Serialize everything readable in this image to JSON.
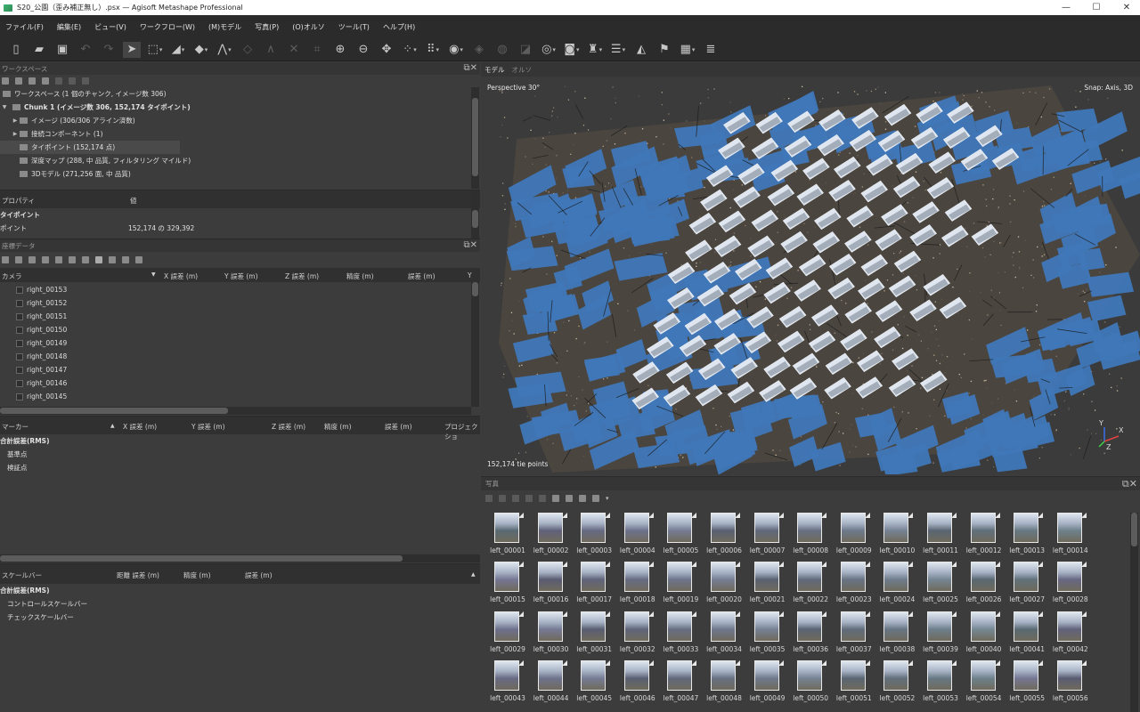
{
  "window": {
    "title": "S20_公園（歪み補正無し）.psx — Agisoft Metashape Professional",
    "controls": [
      "—",
      "☐",
      "✕"
    ]
  },
  "menu": [
    "ファイル(F)",
    "編集(E)",
    "ビュー(V)",
    "ワークフロー(W)",
    "(M)モデル",
    "写真(P)",
    "(O)オルソ",
    "ツール(T)",
    "ヘルプ(H)"
  ],
  "workspace": {
    "title": "ワークスペース",
    "root": "ワークスペース (1 個のチャンク, イメージ数 306)",
    "chunk": "Chunk 1 (イメージ数 306, 152,174 タイポイント)",
    "items": [
      "イメージ (306/306 アライン済数)",
      "接続コンポーネント (1)",
      "タイポイント (152,174 点)",
      "深度マップ (288, 中 品質, フィルタリング マイルド)",
      "3Dモデル (271,256 面, 中 品質)"
    ]
  },
  "properties": {
    "col_property": "プロパティ",
    "col_value": "値",
    "section": "タイポイント",
    "row_label": "ポイント",
    "row_value": "152,174 の 329,392"
  },
  "reference": {
    "title": "座標データ",
    "columns": [
      "カメラ",
      "X 誤差 (m)",
      "Y 誤差 (m)",
      "Z 誤差 (m)",
      "精度 (m)",
      "誤差 (m)",
      "Y"
    ],
    "cameras": [
      "right_00153",
      "right_00152",
      "right_00151",
      "right_00150",
      "right_00149",
      "right_00148",
      "right_00147",
      "right_00146",
      "right_00145"
    ]
  },
  "markers": {
    "columns": [
      "マーカー",
      "X 誤差 (m)",
      "Y 誤差 (m)",
      "Z 誤差 (m)",
      "精度 (m)",
      "誤差 (m)",
      "プロジェクショ"
    ],
    "total": "合計誤差(RMS)",
    "rows": [
      "基準点",
      "検証点"
    ]
  },
  "scalebars": {
    "columns": [
      "スケールバー",
      "距離 誤差 (m)",
      "精度 (m)",
      "誤差 (m)"
    ],
    "total": "合計誤差(RMS)",
    "rows": [
      "コントロールスケールバー",
      "チェックスケールバー"
    ]
  },
  "view_tabs": [
    "モデル",
    "オルソ"
  ],
  "viewport": {
    "projection": "Perspective 30°",
    "snap": "Snap: Axis, 3D",
    "points": "152,174 tie points",
    "axes": [
      "Y",
      "X",
      "Z"
    ]
  },
  "photos": {
    "title": "写真",
    "items": [
      "left_00001",
      "left_00002",
      "left_00003",
      "left_00004",
      "left_00005",
      "left_00006",
      "left_00007",
      "left_00008",
      "left_00009",
      "left_00010",
      "left_00011",
      "left_00012",
      "left_00013",
      "left_00014",
      "left_00015",
      "left_00016",
      "left_00017",
      "left_00018",
      "left_00019",
      "left_00020",
      "left_00021",
      "left_00022",
      "left_00023",
      "left_00024",
      "left_00025",
      "left_00026",
      "left_00027",
      "left_00028",
      "left_00029",
      "left_00030",
      "left_00031",
      "left_00032",
      "left_00033",
      "left_00034",
      "left_00035",
      "left_00036",
      "left_00037",
      "left_00038",
      "left_00039",
      "left_00040",
      "left_00041",
      "left_00042",
      "left_00043",
      "left_00044",
      "left_00045",
      "left_00046",
      "left_00047",
      "left_00048",
      "left_00049",
      "left_00050",
      "left_00051",
      "left_00052",
      "left_00053",
      "left_00054",
      "left_00055",
      "left_00056"
    ]
  },
  "colors": {
    "panel_bg": "#3c3c3c",
    "header_bg": "#2b2b2b",
    "camera_blue": "#3f77b8",
    "selection": "#4a4a4a"
  }
}
